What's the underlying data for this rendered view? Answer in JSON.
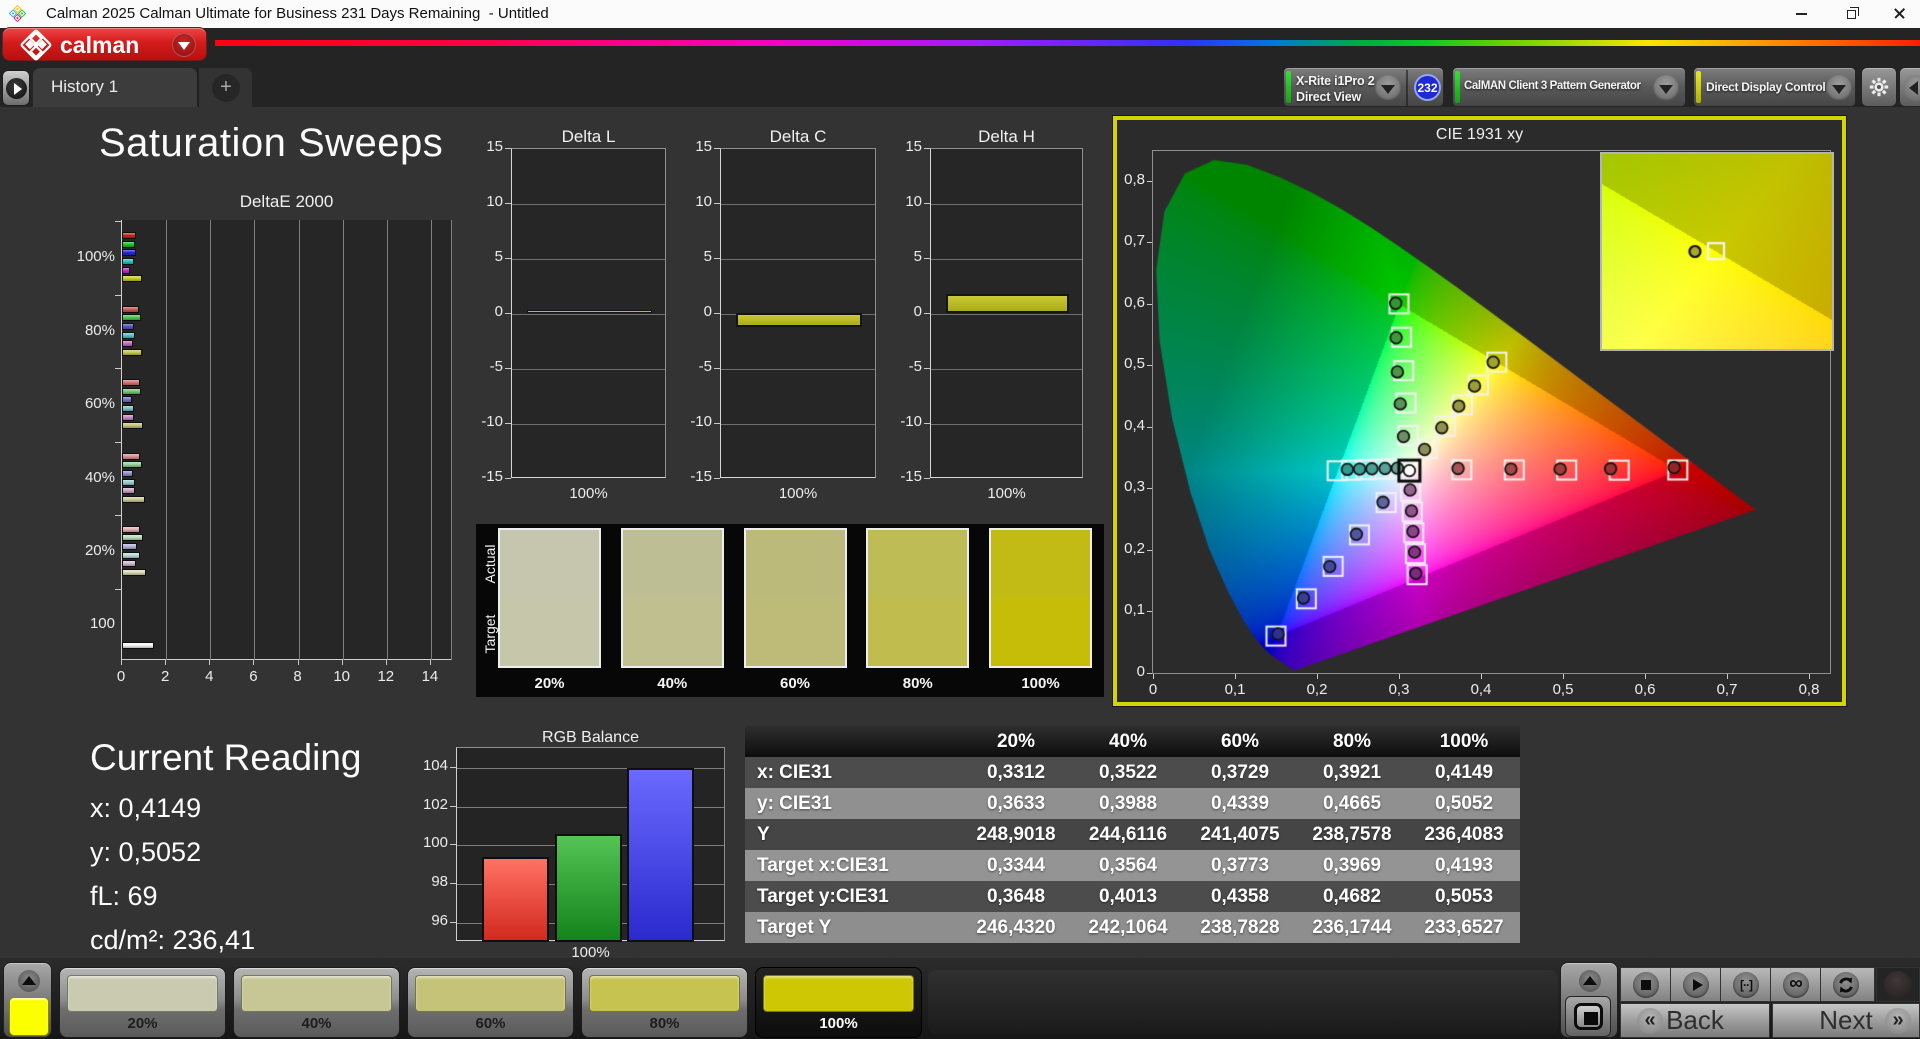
{
  "window": {
    "title": "Calman 2025 Calman Ultimate for Business 231 Days Remaining  - Untitled",
    "icon": "portrait-displays-diamond",
    "controls": [
      "minimize",
      "restore",
      "close"
    ]
  },
  "brand": {
    "wordmark": "calman",
    "accent": "#c41414"
  },
  "tabs": {
    "active": "History 1",
    "add_label": "+"
  },
  "toolbar": {
    "meter": {
      "line1": "X-Rite i1Pro 2",
      "line2": "Direct View",
      "badge": "232",
      "accent": "#25c025",
      "badge_color": "#1f2ad4"
    },
    "generator": {
      "label": "CalMAN Client 3 Pattern Generator",
      "accent": "#25c025"
    },
    "display_control": {
      "label": "Direct Display Control",
      "accent": "#d8d800"
    }
  },
  "page": {
    "heading": "Saturation Sweeps"
  },
  "reading": {
    "title": "Current Reading",
    "items": [
      {
        "label": "x",
        "text": "x: 0,4149"
      },
      {
        "label": "y",
        "text": "y: 0,5052"
      },
      {
        "label": "fL",
        "text": "fL: 69"
      },
      {
        "label": "cd/m2",
        "text": "cd/m²: 236,41"
      }
    ]
  },
  "chart_data": {
    "deltae": {
      "type": "bar",
      "title": "DeltaE 2000",
      "orientation": "horizontal",
      "xlim": [
        0,
        15
      ],
      "xticks": [
        "0",
        "2",
        "4",
        "6",
        "8",
        "10",
        "12",
        "14"
      ],
      "xtick_values": [
        0,
        2,
        4,
        6,
        8,
        10,
        12,
        14
      ],
      "series_order": [
        "Red",
        "Green",
        "Blue",
        "Cyan",
        "Magenta",
        "Yellow"
      ],
      "groups": [
        {
          "label": "100%",
          "values": [
            0.62,
            0.58,
            0.62,
            0.52,
            0.38,
            0.92
          ],
          "colors": [
            "#d42020",
            "#1ec81e",
            "#2a2ad8",
            "#1fc8c8",
            "#d428d4",
            "#cfcf24"
          ]
        },
        {
          "label": "80%",
          "values": [
            0.78,
            0.85,
            0.52,
            0.58,
            0.5,
            0.9
          ],
          "colors": [
            "#d45858",
            "#52c852",
            "#5858c8",
            "#58c8c8",
            "#c870c8",
            "#c8c85a"
          ]
        },
        {
          "label": "60%",
          "values": [
            0.8,
            0.85,
            0.45,
            0.52,
            0.55,
            0.95
          ],
          "colors": [
            "#d47878",
            "#78c878",
            "#7878c8",
            "#78c8c8",
            "#c88cc8",
            "#c8c87c"
          ]
        },
        {
          "label": "40%",
          "values": [
            0.8,
            0.9,
            0.5,
            0.6,
            0.6,
            1.05
          ],
          "colors": [
            "#dc9494",
            "#9cd49c",
            "#9494d0",
            "#9cd0d0",
            "#d0a8d0",
            "#d0d09c"
          ]
        },
        {
          "label": "20%",
          "values": [
            0.81,
            0.95,
            0.7,
            0.81,
            0.62,
            1.1
          ],
          "colors": [
            "#e4b4b4",
            "#bce0bc",
            "#b4b4dc",
            "#bcdcdc",
            "#d4bcd4",
            "#dcdcb8"
          ]
        },
        {
          "label": "100",
          "values": [
            1.45
          ],
          "colors": [
            "#f4f4f4"
          ]
        }
      ]
    },
    "delta_l": {
      "type": "bar",
      "title": "Delta L",
      "ylim": [
        -15,
        15
      ],
      "yticks": [
        "15",
        "10",
        "5",
        "0",
        "-5",
        "-10",
        "-15"
      ],
      "ytick_values": [
        15,
        10,
        5,
        0,
        -5,
        -10,
        -15
      ],
      "categories": [
        "100%"
      ],
      "values": [
        0.32
      ],
      "bar_color": "#b9bc24"
    },
    "delta_c": {
      "type": "bar",
      "title": "Delta C",
      "ylim": [
        -15,
        15
      ],
      "yticks": [
        "15",
        "10",
        "5",
        "0",
        "-5",
        "-10",
        "-15"
      ],
      "ytick_values": [
        15,
        10,
        5,
        0,
        -5,
        -10,
        -15
      ],
      "categories": [
        "100%"
      ],
      "values": [
        -1.25
      ],
      "bar_color": "#b9bc24"
    },
    "delta_h": {
      "type": "bar",
      "title": "Delta H",
      "ylim": [
        -15,
        15
      ],
      "yticks": [
        "15",
        "10",
        "5",
        "0",
        "-5",
        "-10",
        "-15"
      ],
      "ytick_values": [
        15,
        10,
        5,
        0,
        -5,
        -10,
        -15
      ],
      "categories": [
        "100%"
      ],
      "values": [
        1.7
      ],
      "bar_color": "#b9bc24"
    },
    "rgb_balance": {
      "type": "bar",
      "title": "RGB Balance",
      "ylim": [
        95,
        105.03
      ],
      "yticks": [
        "96",
        "98",
        "100",
        "102",
        "104"
      ],
      "ytick_values": [
        96,
        98,
        100,
        102,
        104
      ],
      "categories": [
        "100%"
      ],
      "series": [
        {
          "name": "Red",
          "value": 99.4,
          "color_top": "#ff7263",
          "color_bottom": "#d3291f"
        },
        {
          "name": "Green",
          "value": 100.6,
          "color_top": "#55c455",
          "color_bottom": "#13831b"
        },
        {
          "name": "Blue",
          "value": 104.0,
          "color_top": "#6a6aff",
          "color_bottom": "#2a2ace"
        }
      ]
    },
    "cie": {
      "type": "scatter",
      "title": "CIE 1931 xy",
      "xlim": [
        0,
        0.8256
      ],
      "ylim": [
        0,
        0.8486
      ],
      "xticks": [
        "0",
        "0,1",
        "0,2",
        "0,3",
        "0,4",
        "0,5",
        "0,6",
        "0,7",
        "0,8"
      ],
      "yticks": [
        "0",
        "0,1",
        "0,2",
        "0,3",
        "0,4",
        "0,5",
        "0,6",
        "0,7",
        "0,8"
      ],
      "xtick_values": [
        0,
        0.1,
        0.2,
        0.3,
        0.4,
        0.5,
        0.6,
        0.7,
        0.8
      ],
      "ytick_values": [
        0,
        0.1,
        0.2,
        0.3,
        0.4,
        0.5,
        0.6,
        0.7,
        0.8
      ],
      "gamut_triangle": {
        "red": [
          0.64,
          0.33
        ],
        "green": [
          0.3,
          0.6
        ],
        "blue": [
          0.15,
          0.06
        ]
      },
      "whitepoint": {
        "target": [
          0.3127,
          0.329
        ],
        "measured": [
          0.3127,
          0.329
        ]
      },
      "sweeps": [
        {
          "name": "red",
          "targets": [
            [
              0.3766,
              0.3303
            ],
            [
              0.4406,
              0.3301
            ],
            [
              0.5045,
              0.3299
            ],
            [
              0.5685,
              0.3297
            ],
            [
              0.64,
              0.33
            ]
          ],
          "measured": [
            [
              0.372,
              0.3325
            ],
            [
              0.4365,
              0.3315
            ],
            [
              0.4965,
              0.3315
            ],
            [
              0.558,
              0.332
            ],
            [
              0.6355,
              0.334
            ]
          ],
          "dot_colors": [
            "#a85454",
            "#a64848",
            "#a23c3c",
            "#9d3131",
            "#952525"
          ]
        },
        {
          "name": "green",
          "targets": [
            [
              0.3111,
              0.3862
            ],
            [
              0.3085,
              0.4389
            ],
            [
              0.3058,
              0.4915
            ],
            [
              0.3031,
              0.5458
            ],
            [
              0.3,
              0.6
            ]
          ],
          "measured": [
            [
              0.3055,
              0.3845
            ],
            [
              0.3015,
              0.4375
            ],
            [
              0.298,
              0.4895
            ],
            [
              0.2965,
              0.545
            ],
            [
              0.296,
              0.601
            ]
          ],
          "dot_colors": [
            "#6b8f63",
            "#5c9256",
            "#4d9548",
            "#3f983b",
            "#2f9a2f"
          ]
        },
        {
          "name": "blue",
          "targets": [
            [
              0.2843,
              0.277
            ],
            [
              0.2518,
              0.2245
            ],
            [
              0.2197,
              0.1733
            ],
            [
              0.187,
              0.1206
            ],
            [
              0.15,
              0.06
            ]
          ],
          "measured": [
            [
              0.2805,
              0.2775
            ],
            [
              0.248,
              0.2255
            ],
            [
              0.2155,
              0.173
            ],
            [
              0.1835,
              0.122
            ],
            [
              0.1525,
              0.0635
            ]
          ],
          "dot_colors": [
            "#5d64a0",
            "#4f579e",
            "#42499b",
            "#363d98",
            "#2c3195"
          ]
        },
        {
          "name": "cyan",
          "targets": [
            [
              0.295,
              0.332
            ],
            [
              0.2775,
              0.3312
            ],
            [
              0.2599,
              0.3304
            ],
            [
              0.2423,
              0.3296
            ],
            [
              0.2246,
              0.3287
            ]
          ],
          "measured": [
            [
              0.298,
              0.333
            ],
            [
              0.283,
              0.3325
            ],
            [
              0.267,
              0.332
            ],
            [
              0.252,
              0.3315
            ],
            [
              0.237,
              0.331
            ]
          ],
          "dot_colors": [
            "#68a099",
            "#58a29a",
            "#489f96",
            "#3a9d93",
            "#2f9a90"
          ]
        },
        {
          "name": "magenta",
          "targets": [
            [
              0.3142,
              0.2958
            ],
            [
              0.3161,
              0.2619
            ],
            [
              0.318,
              0.228
            ],
            [
              0.32,
              0.194
            ],
            [
              0.3221,
              0.1598
            ]
          ],
          "measured": [
            [
              0.3135,
              0.2975
            ],
            [
              0.3152,
              0.2635
            ],
            [
              0.317,
              0.23
            ],
            [
              0.319,
              0.1965
            ],
            [
              0.3205,
              0.162
            ]
          ],
          "dot_colors": [
            "#96638f",
            "#91538b",
            "#8b4487",
            "#853583",
            "#7e2a7e"
          ]
        },
        {
          "name": "yellow",
          "targets": [
            [
              0.3344,
              0.3648
            ],
            [
              0.3564,
              0.4013
            ],
            [
              0.3773,
              0.4358
            ],
            [
              0.3969,
              0.4682
            ],
            [
              0.4193,
              0.5053
            ]
          ],
          "measured": [
            [
              0.3312,
              0.3633
            ],
            [
              0.3522,
              0.3988
            ],
            [
              0.3729,
              0.4339
            ],
            [
              0.3921,
              0.4665
            ],
            [
              0.4149,
              0.5052
            ]
          ],
          "dot_colors": [
            "#8e8e59",
            "#92924e",
            "#979743",
            "#9c9c38",
            "#a2a22b"
          ]
        }
      ],
      "inset": {
        "window_x": [
          0.3955,
          0.4435
        ],
        "window_y": [
          0.47785,
          0.53255
        ],
        "measured": [
          0.4149,
          0.5052
        ],
        "target": [
          0.4193,
          0.5053
        ],
        "dot_color": "#a8a82a"
      }
    }
  },
  "swatches": {
    "row_labels": [
      "Actual",
      "Target"
    ],
    "labels": [
      "20%",
      "40%",
      "60%",
      "80%",
      "100%"
    ],
    "actual": [
      "#c5c6ad",
      "#bdbe93",
      "#bcba7a",
      "#bebc55",
      "#c2bb16"
    ],
    "target": [
      "#c6c7aa",
      "#bfbf90",
      "#bdbb77",
      "#c0bd4e",
      "#c5bd08"
    ]
  },
  "table": {
    "headers": [
      "",
      "20%",
      "40%",
      "60%",
      "80%",
      "100%"
    ],
    "rows": [
      {
        "label": "x: CIE31",
        "values": [
          "0,3312",
          "0,3522",
          "0,3729",
          "0,3921",
          "0,4149"
        ]
      },
      {
        "label": "y: CIE31",
        "values": [
          "0,3633",
          "0,3988",
          "0,4339",
          "0,4665",
          "0,5052"
        ]
      },
      {
        "label": "Y",
        "values": [
          "248,9018",
          "244,6116",
          "241,4075",
          "238,7578",
          "236,4083"
        ]
      },
      {
        "label": "Target x:CIE31",
        "values": [
          "0,3344",
          "0,3564",
          "0,3773",
          "0,3969",
          "0,4193"
        ]
      },
      {
        "label": "Target y:CIE31",
        "values": [
          "0,3648",
          "0,4013",
          "0,4358",
          "0,4682",
          "0,5053"
        ]
      },
      {
        "label": "Target Y",
        "values": [
          "246,4320",
          "242,1064",
          "238,7828",
          "236,1744",
          "233,6527"
        ]
      }
    ]
  },
  "bottom": {
    "current_pattern_color": "#fcff00",
    "pattern_buttons": [
      {
        "label": "20%",
        "color": "#c9cab0",
        "selected": false
      },
      {
        "label": "40%",
        "color": "#c6c795",
        "selected": false
      },
      {
        "label": "60%",
        "color": "#c5c378",
        "selected": false
      },
      {
        "label": "80%",
        "color": "#c6c351",
        "selected": false
      },
      {
        "label": "100%",
        "color": "#cdc704",
        "selected": true
      }
    ],
    "transport": [
      {
        "name": "stop",
        "glyph": "stop-square"
      },
      {
        "name": "play",
        "glyph": "play-triangle"
      },
      {
        "name": "measure-frame",
        "glyph": "bracket-dots"
      },
      {
        "name": "continuous",
        "glyph": "infinity"
      },
      {
        "name": "refresh",
        "glyph": "refresh-arrows"
      }
    ],
    "back_label": "Back",
    "next_label": "Next",
    "back_chevron": "«",
    "next_chevron": "»"
  }
}
